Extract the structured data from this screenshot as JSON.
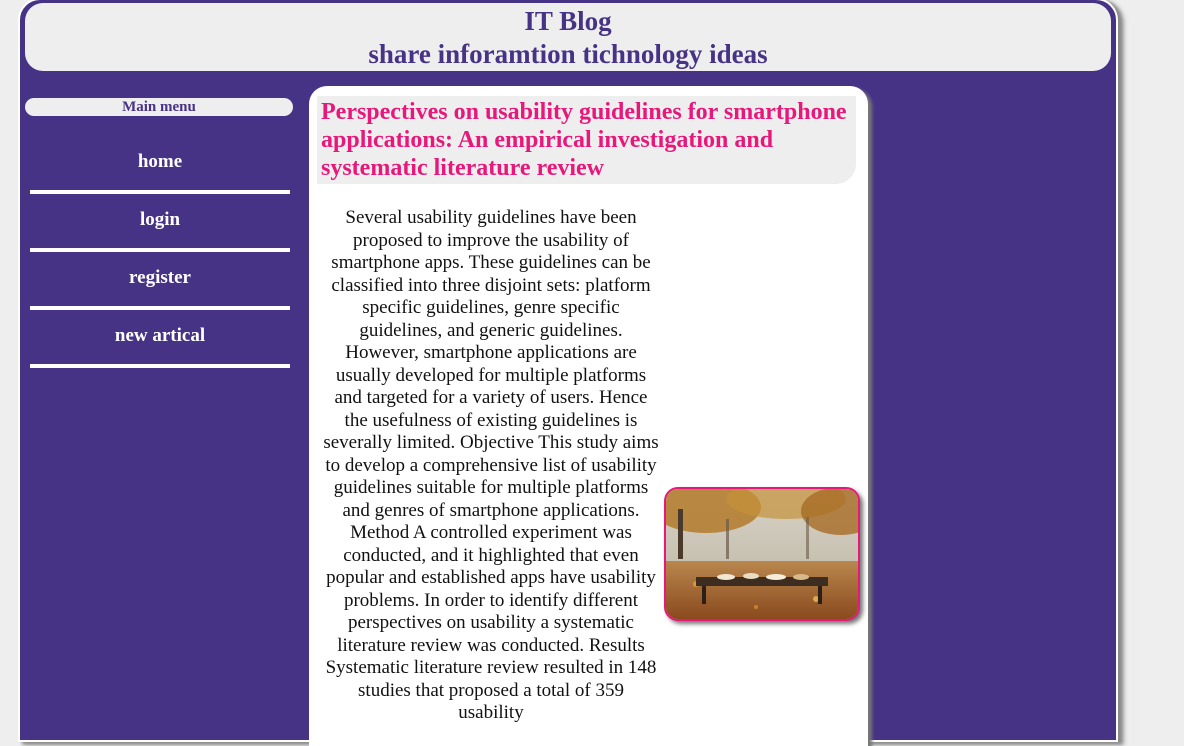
{
  "header": {
    "title": "IT Blog",
    "subtitle": "share inforamtion tichnology ideas"
  },
  "sidebar": {
    "menu_title": "Main menu",
    "items": [
      {
        "label": "home"
      },
      {
        "label": "login"
      },
      {
        "label": "register"
      },
      {
        "label": "new artical"
      }
    ]
  },
  "article": {
    "title": "Perspectives on usability guidelines for smartphone applications: An empirical investigation and systematic literature review",
    "body": "Several usability guidelines have been proposed to improve the usability of smartphone apps. These guidelines can be classified into three disjoint sets: platform specific guidelines, genre specific guidelines, and generic guidelines. However, smartphone applications are usually developed for multiple platforms and targeted for a variety of users. Hence the usefulness of existing guidelines is severally limited. Objective This study aims to develop a comprehensive list of usability guidelines suitable for multiple platforms and genres of smartphone applications. Method A controlled experiment was conducted, and it highlighted that even popular and established apps have usability problems. In order to identify different perspectives on usability a systematic literature review was conducted. Results Systematic literature review resulted in 148 studies that proposed a total of 359 usability",
    "image": "autumn-forest-picnic-table-photo"
  },
  "colors": {
    "page_bg": "#473386",
    "header_bg": "#eeeeee",
    "title_color": "#473386",
    "article_title_color": "#e8177a"
  }
}
